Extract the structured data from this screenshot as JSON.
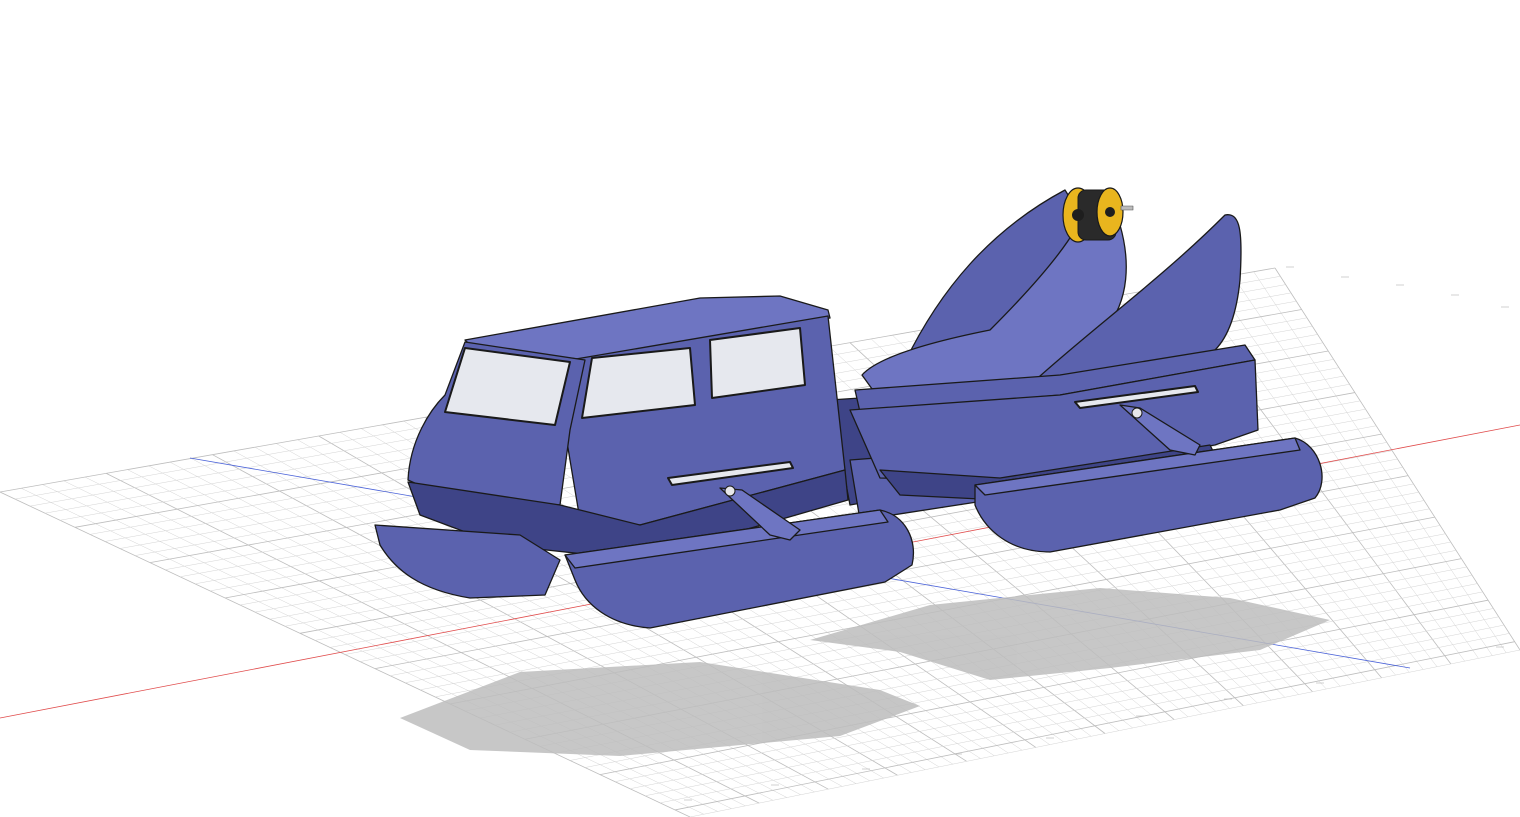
{
  "viewport": {
    "background": "#ffffff",
    "grid_color": "#d4d4d4",
    "grid_major_color": "#bdbdbd",
    "x_axis_color": "#e04b4b",
    "y_axis_color": "#4a62d8"
  },
  "model": {
    "body_color": "#5b62ae",
    "body_light": "#6e75c2",
    "body_dark": "#3e4487",
    "edge_color": "#1a1a1a",
    "glass_color": "#e6e8ee",
    "motor_color": "#e9b51e"
  },
  "ruler": {
    "labels": [
      "",
      "",
      "",
      "",
      "",
      "",
      "",
      "",
      "",
      "",
      "",
      "",
      "",
      "",
      ""
    ]
  }
}
